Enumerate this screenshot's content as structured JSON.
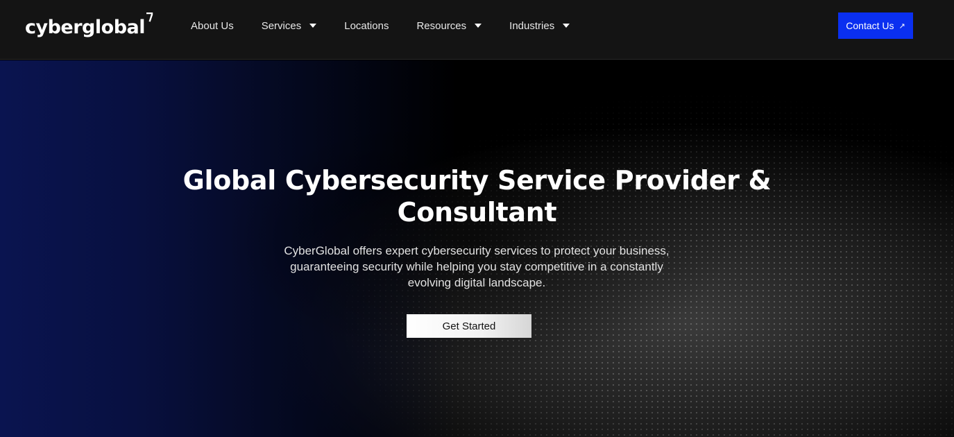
{
  "brand": {
    "logo_text": "cyberglobal"
  },
  "nav": {
    "items": [
      {
        "label": "About Us",
        "has_dropdown": false
      },
      {
        "label": "Services",
        "has_dropdown": true
      },
      {
        "label": "Locations",
        "has_dropdown": false
      },
      {
        "label": "Resources",
        "has_dropdown": true
      },
      {
        "label": "Industries",
        "has_dropdown": true
      }
    ],
    "contact_label": "Contact Us"
  },
  "hero": {
    "title_line1": "Global Cybersecurity Service Provider &",
    "title_line2": "Consultant",
    "subtitle_line1": "CyberGlobal offers expert cybersecurity services to protect your business,",
    "subtitle_line2": "guaranteeing security while helping you stay competitive in a constantly",
    "subtitle_line3": "evolving digital landscape.",
    "cta_label": "Get Started"
  },
  "colors": {
    "accent": "#0a2ff0",
    "navbar_bg": "#141414",
    "hero_left_glow": "#0a1450"
  },
  "icons": {
    "logo_mark": "corner-mark-icon",
    "dropdown": "caret-down-icon",
    "external": "arrow-up-right-icon"
  }
}
